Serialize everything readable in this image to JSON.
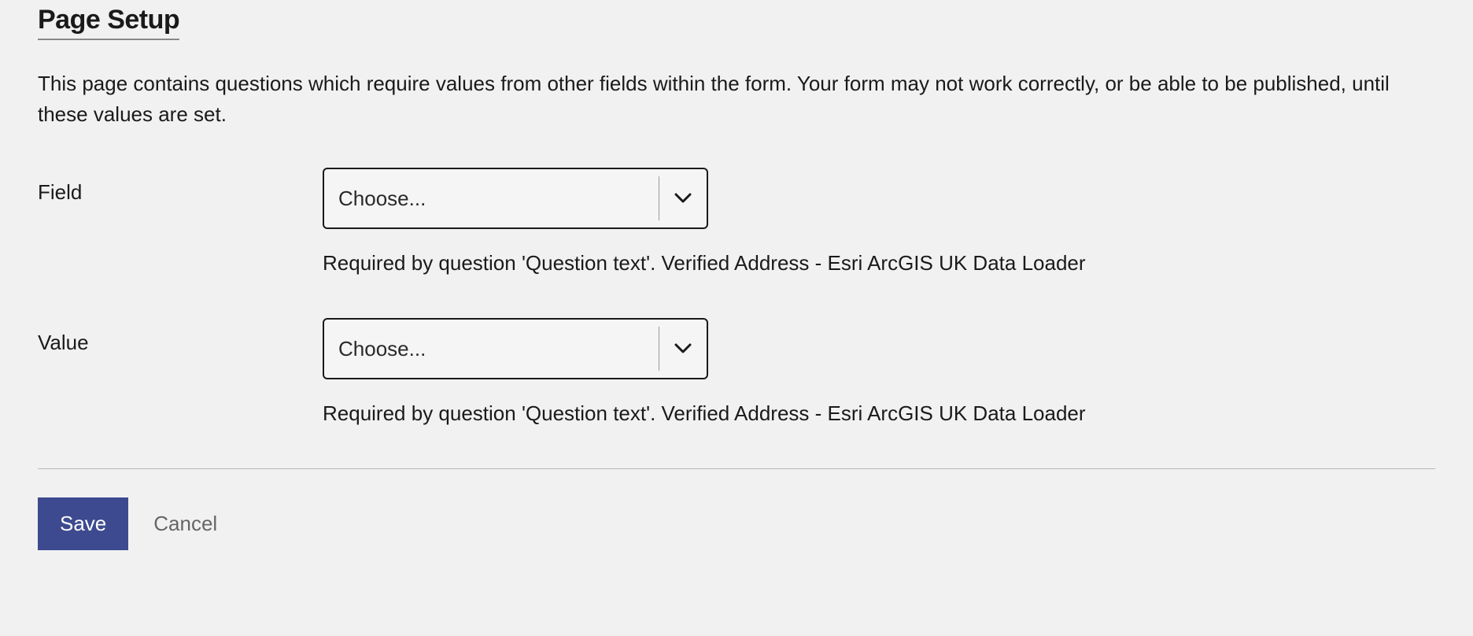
{
  "header": {
    "title": "Page Setup"
  },
  "description": "This page contains questions which require values from other fields within the form. Your form may not work correctly, or be able to be published, until these values are set.",
  "fields": {
    "field": {
      "label": "Field",
      "selected": "Choose...",
      "helper": "Required by question 'Question text'. Verified Address - Esri ArcGIS UK Data Loader"
    },
    "value": {
      "label": "Value",
      "selected": "Choose...",
      "helper": "Required by question 'Question text'. Verified Address - Esri ArcGIS UK Data Loader"
    }
  },
  "buttons": {
    "save": "Save",
    "cancel": "Cancel"
  }
}
